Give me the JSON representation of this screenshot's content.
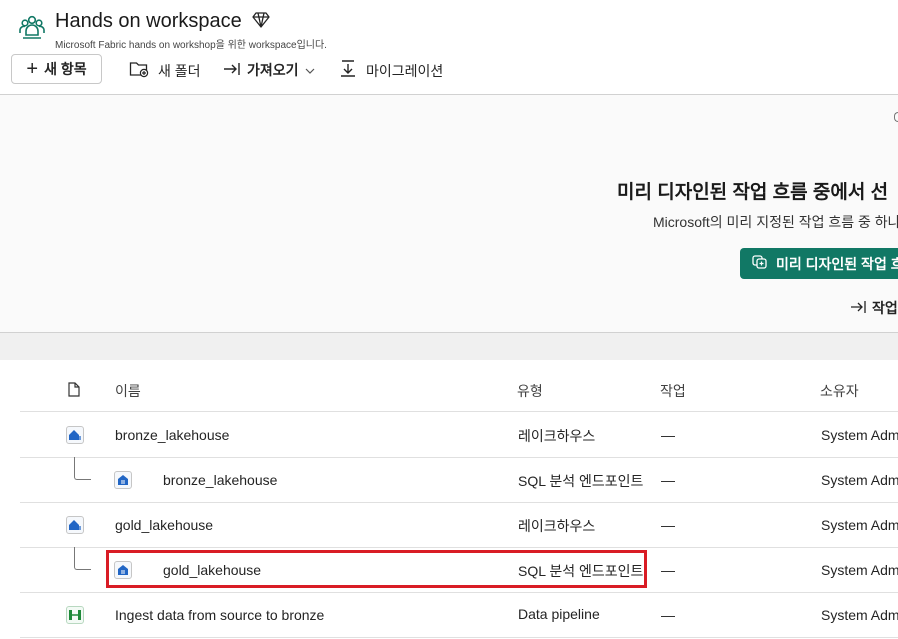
{
  "workspace": {
    "title": "Hands on workspace",
    "subtitle": "Microsoft Fabric hands on workshop을 위한 workspace입니다."
  },
  "toolbar": {
    "new_item": "새 항목",
    "new_folder": "새 폴더",
    "import": "가져오기",
    "migration": "마이그레이션"
  },
  "hero": {
    "title": "미리 디자인된 작업 흐름 중에서 선",
    "description": "Microsoft의 미리 지정된 작업 흐름 중 하나",
    "cta": "미리 디자인된 작업 흐",
    "link": "작업"
  },
  "table": {
    "headers": {
      "name": "이름",
      "type": "유형",
      "task": "작업",
      "owner": "소유자"
    },
    "rows": [
      {
        "name": "bronze_lakehouse",
        "type": "레이크하우스",
        "task": "—",
        "owner": "System Adm",
        "icon": "lakehouse-icon"
      },
      {
        "name": "bronze_lakehouse",
        "type": "SQL 분석 엔드포인트",
        "task": "—",
        "owner": "System Adm",
        "icon": "sql-endpoint-icon"
      },
      {
        "name": "gold_lakehouse",
        "type": "레이크하우스",
        "task": "—",
        "owner": "System Adm",
        "icon": "lakehouse-icon"
      },
      {
        "name": "gold_lakehouse",
        "type": "SQL 분석 엔드포인트",
        "task": "—",
        "owner": "System Adm",
        "icon": "sql-endpoint-icon"
      },
      {
        "name": "Ingest data from source to bronze",
        "type": "Data pipeline",
        "task": "—",
        "owner": "System Adm",
        "icon": "pipeline-icon"
      }
    ]
  },
  "colors": {
    "accent": "#117865",
    "highlight": "#d91c25",
    "lakehouse": "#2266c5",
    "pipeline": "#1f8a3a"
  }
}
